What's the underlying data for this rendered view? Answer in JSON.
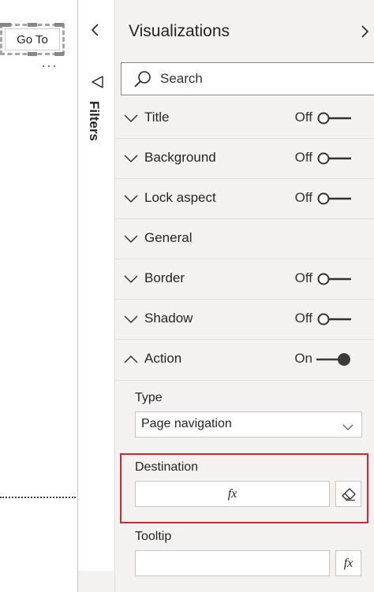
{
  "canvas": {
    "goto_button_label": "Go To",
    "more_options": "···"
  },
  "filters": {
    "label": "Filters"
  },
  "visualizations": {
    "title": "Visualizations",
    "search_placeholder": "Search",
    "sections": [
      {
        "label": "Title",
        "state": "Off",
        "expanded": false
      },
      {
        "label": "Background",
        "state": "Off",
        "expanded": false
      },
      {
        "label": "Lock aspect",
        "state": "Off",
        "expanded": false
      },
      {
        "label": "General",
        "state": "",
        "expanded": false
      },
      {
        "label": "Border",
        "state": "Off",
        "expanded": false
      },
      {
        "label": "Shadow",
        "state": "Off",
        "expanded": false
      },
      {
        "label": "Action",
        "state": "On",
        "expanded": true
      }
    ],
    "action": {
      "type_label": "Type",
      "type_value": "Page navigation",
      "destination_label": "Destination",
      "destination_fx": "fx",
      "tooltip_label": "Tooltip",
      "tooltip_fx": "fx"
    }
  },
  "colors": {
    "highlight": "#d9262c",
    "pane_bg": "#f3f2f1",
    "toggle_on": "#3b3a39"
  }
}
